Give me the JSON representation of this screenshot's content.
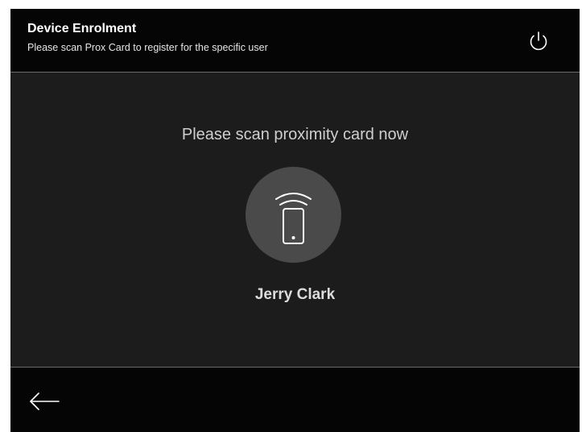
{
  "header": {
    "title": "Device Enrolment",
    "subtitle": "Please scan Prox Card to register for the specific user",
    "power_icon": "power-icon"
  },
  "main": {
    "instruction": "Please scan proximity card now",
    "scan_icon": "proximity-card-scan-icon",
    "user_name": "Jerry Clark"
  },
  "footer": {
    "back_icon": "back-arrow-icon"
  },
  "colors": {
    "header_bg": "#050505",
    "main_bg": "#1c1c1c",
    "icon_circle": "#4a4a4a",
    "text_primary": "#ffffff",
    "text_secondary": "#cfcfcf"
  }
}
